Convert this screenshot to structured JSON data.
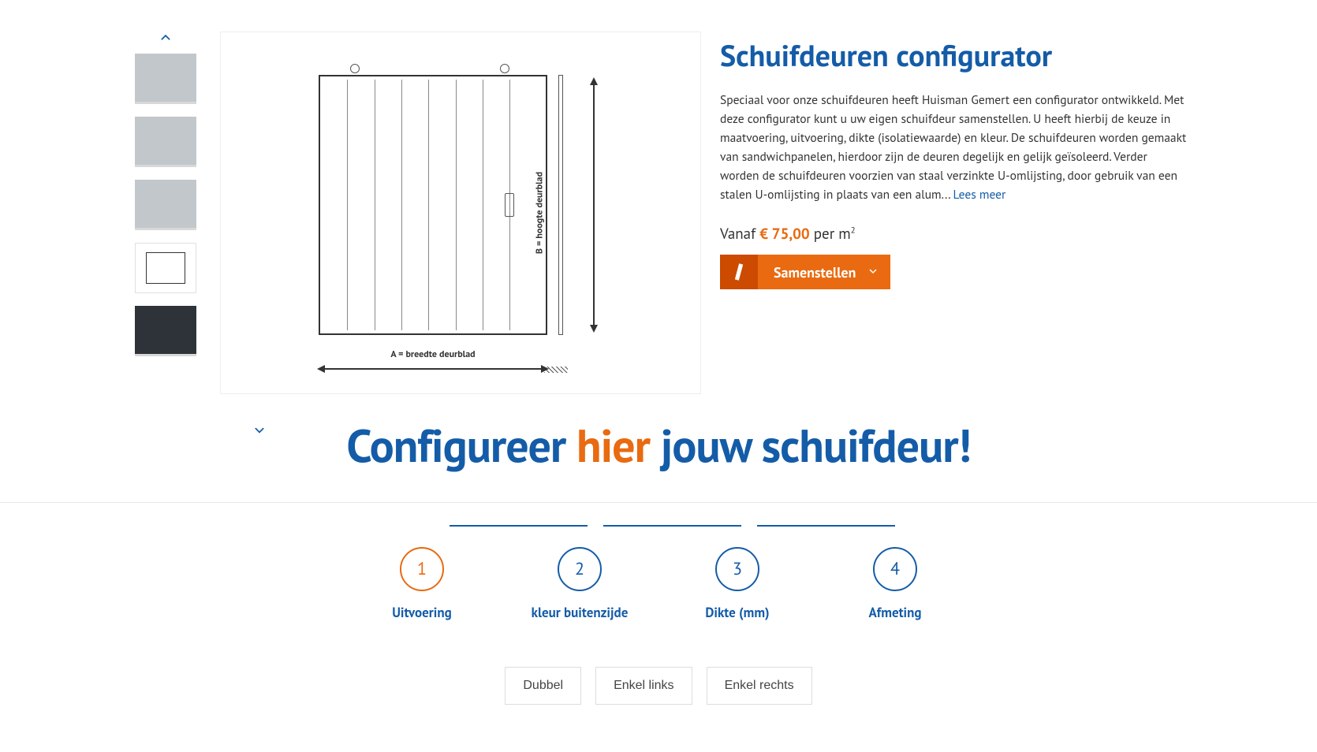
{
  "product": {
    "title": "Schuifdeuren configurator",
    "description": "Speciaal voor onze schuifdeuren heeft Huisman Gemert een configurator ontwikkeld. Met deze configurator kunt u uw eigen schuifdeur samenstellen. U heeft hierbij de keuze in maatvoering, uitvoering, dikte (isolatiewaarde) en kleur. De schuifdeuren worden gemaakt van sandwichpanelen, hierdoor zijn de deuren degelijk en gelijk geïsoleerd. Verder worden de schuifdeuren voorzien van staal verzinkte U-omlijsting, door gebruik van een stalen U-omlijsting in plaats van een alum... ",
    "read_more": "Lees meer",
    "price_prefix": "Vanaf ",
    "price_amount": "€ 75,00",
    "price_suffix": " per m",
    "price_exp": "2",
    "cta_label": "Samenstellen",
    "diagram": {
      "width_label": "A = breedte deurblad",
      "height_label": "B = hoogte deurblad"
    }
  },
  "banner": {
    "part1": "Configureer ",
    "accent": "hier",
    "part2": " jouw schuifdeur!"
  },
  "steps": [
    {
      "num": "1",
      "label": "Uitvoering",
      "active": true
    },
    {
      "num": "2",
      "label": "kleur buitenzijde",
      "active": false
    },
    {
      "num": "3",
      "label": "Dikte (mm)",
      "active": false
    },
    {
      "num": "4",
      "label": "Afmeting",
      "active": false
    }
  ],
  "options": [
    "Dubbel",
    "Enkel links",
    "Enkel rechts"
  ]
}
